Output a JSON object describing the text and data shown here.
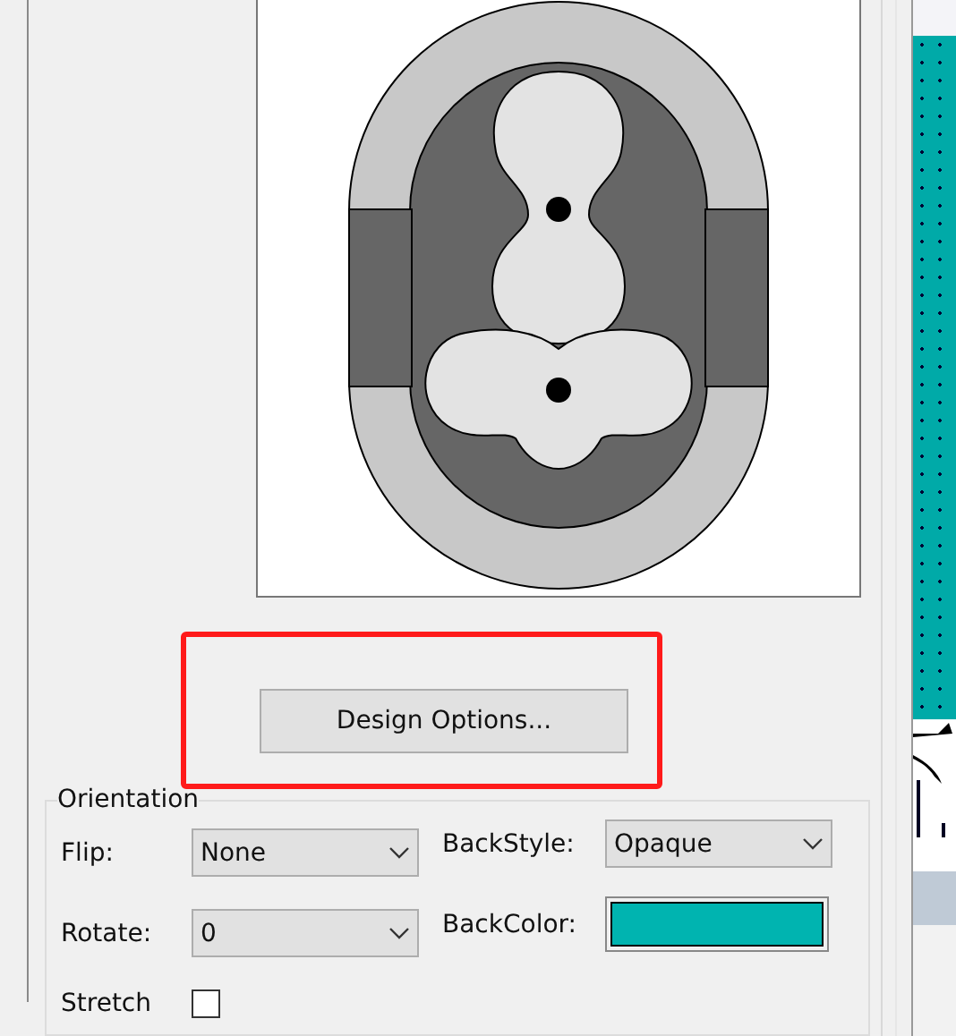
{
  "design_button": {
    "label": "Design Options..."
  },
  "orientation": {
    "title": "Orientation",
    "controls": [
      {
        "kind": "dropdown",
        "label": "Flip:",
        "value": "None"
      },
      {
        "kind": "dropdown",
        "label": "BackStyle:",
        "value": "Opaque"
      },
      {
        "kind": "dropdown",
        "label": "Rotate:",
        "value": "0"
      },
      {
        "kind": "color",
        "label": "BackColor:",
        "color": "#00b4b0"
      },
      {
        "kind": "checkbox",
        "label": "Stretch",
        "checked": false
      }
    ]
  }
}
